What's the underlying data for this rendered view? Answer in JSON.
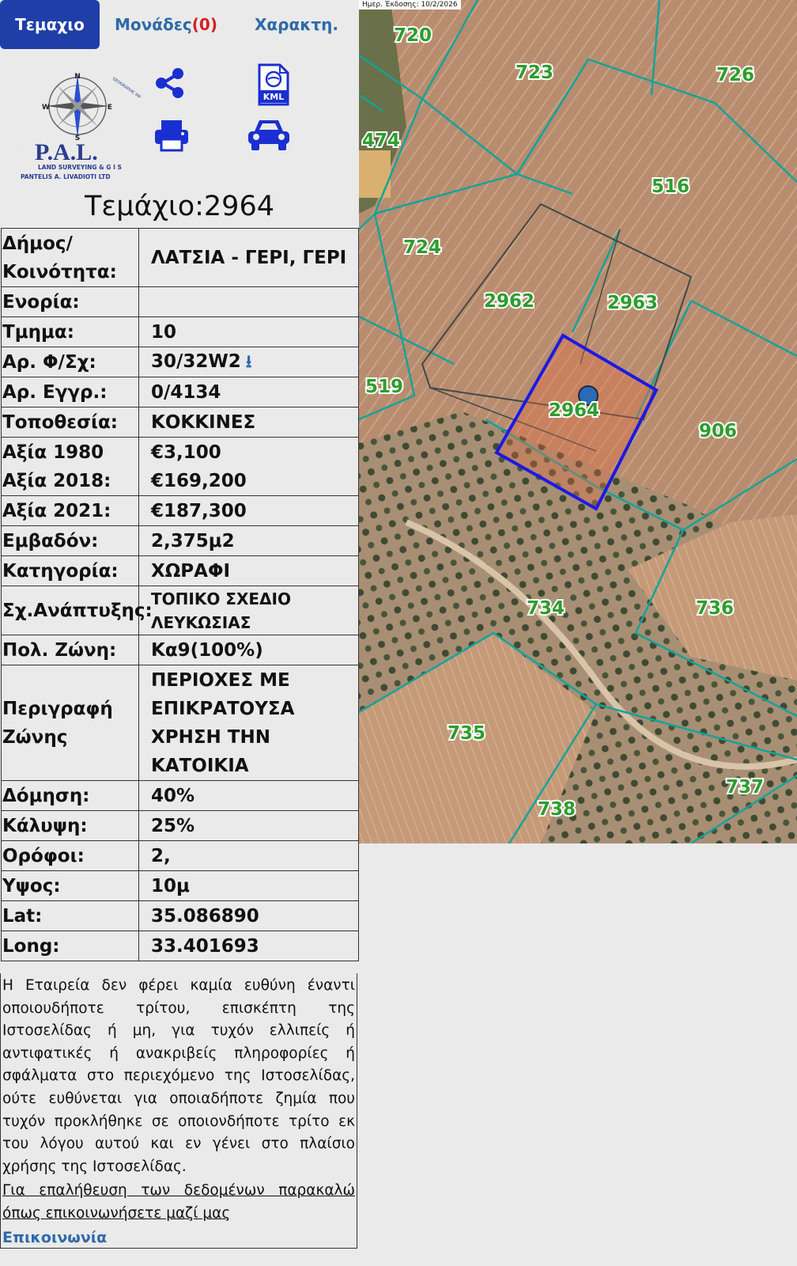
{
  "tabs": [
    {
      "label": "Τεμαχιο",
      "active": true
    },
    {
      "label": "Μονάδες",
      "count": "(0)",
      "active": false
    },
    {
      "label": "Χαρακτη.",
      "active": false
    }
  ],
  "logo": {
    "name": "P.A.L.",
    "line1": "LAND SURVEYING & G I S",
    "line2": "PANTELIS A. LIVADIOTI LTD",
    "ring": "GEOGRAPHIC INFORMATION SYSTEMS"
  },
  "actions": {
    "share_icon": "share-icon",
    "kml_label": "KML",
    "print_icon": "printer-icon",
    "car_icon": "car-icon"
  },
  "title": "Τεμάχιο:2964",
  "info": [
    {
      "label": "Δήμος/ Κοινότητα:",
      "value": "ΛΑΤΣΙΑ - ΓΕΡΙ, ΓΕΡΙ"
    },
    {
      "label": "Ενορία:",
      "value": ""
    },
    {
      "label": "Τμημα:",
      "value": "10"
    },
    {
      "label": "Αρ. Φ/Σχ:",
      "value": "30/32W2"
    },
    {
      "label": "Αρ. Εγγρ.:",
      "value": "0/4134"
    },
    {
      "label": "Τοποθεσία:",
      "value": "ΚΟΚΚΙΝΕΣ"
    },
    {
      "label": "Αξία 1980",
      "value": "€3,100"
    },
    {
      "label": "Αξία 2018:",
      "value": "€169,200"
    },
    {
      "label": "Αξία 2021:",
      "value": "€187,300"
    },
    {
      "label": "Εμβαδόν:",
      "value": "2,375μ2"
    },
    {
      "label": "Κατηγορία:",
      "value": "ΧΩΡΑΦΙ"
    },
    {
      "label": "Σχ.Ανάπτυξης:",
      "value": "ΤΟΠΙΚΟ ΣΧΕΔΙΟ ΛΕΥΚΩΣΙΑΣ"
    },
    {
      "label": "Πολ. Ζώνη:",
      "value": "Κα9(100%)"
    },
    {
      "label": "Περιγραφή Ζώνης",
      "value": "ΠΕΡΙΟΧΕΣ ΜΕ ΕΠΙΚΡΑΤΟΥΣΑ ΧΡΗΣΗ ΤΗΝ ΚΑΤΟΙΚΙΑ"
    },
    {
      "label": "Δόμηση:",
      "value": "40%"
    },
    {
      "label": "Κάλυψη:",
      "value": "25%"
    },
    {
      "label": "Ορόφοι:",
      "value": "2,"
    },
    {
      "label": "Υψος:",
      "value": "10μ"
    },
    {
      "label": "Lat:",
      "value": "35.086890"
    },
    {
      "label": "Long:",
      "value": "33.401693"
    }
  ],
  "disclaimer": "Η Εταιρεία δεν φέρει καμία ευθύνη έναντι οποιουδήποτε τρίτου, επισκέπτη της Ιστοσελίδας ή μη, για τυχόν ελλιπείς ή αντιφατικές ή ανακριβείς πληροφορίες ή σφάλματα στο περιεχόμενο της Ιστοσελίδας, ούτε ευθύνεται για οποιαδήποτε ζημία που τυχόν προκλήθηκε σε οποιονδήποτε τρίτο εκ του λόγου αυτού και εν γένει στο πλαίσιο χρήσης της Ιστοσελίδας.",
  "verify_text": "Για επαλήθευση των δεδομένων παρακαλώ όπως επικοινωνήσετε μαζί μας",
  "contact_link": "Επικοινωνία",
  "map": {
    "date_label": "Ημερ. Έκδοσης: 10/2/2026",
    "parcels": [
      "720",
      "723",
      "726",
      "474",
      "516",
      "724",
      "2962",
      "2963",
      "519",
      "2964",
      "906",
      "734",
      "736",
      "735",
      "737",
      "738"
    ],
    "colors": {
      "boundary": "#13a39a",
      "selected": "#1a1ae6",
      "label": "#2e9d2e"
    }
  }
}
